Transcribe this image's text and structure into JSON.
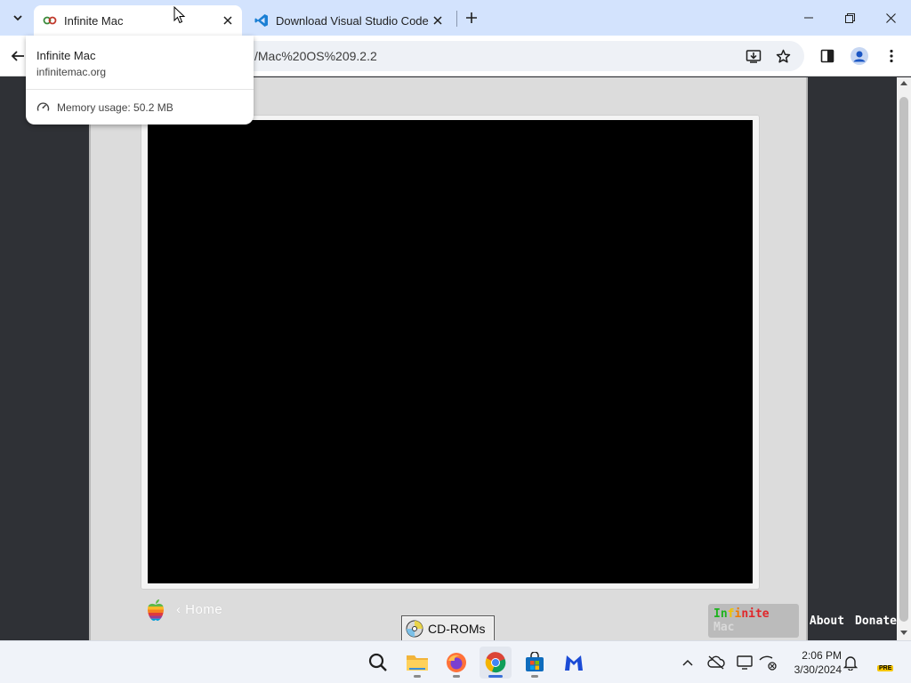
{
  "browser": {
    "tabs": [
      {
        "title": "Infinite Mac",
        "active": true,
        "favicon": "infinite-mac-icon"
      },
      {
        "title": "Download Visual Studio Code",
        "active": false,
        "favicon": "vscode-icon"
      }
    ],
    "address_bar": {
      "url_fragment": "/Mac%20OS%209.2.2"
    },
    "hover_card": {
      "title": "Infinite Mac",
      "domain": "infinitemac.org",
      "memory": "Memory usage: 50.2 MB"
    }
  },
  "page": {
    "home_link": "‹ Home",
    "cd_button": "CD-ROMs",
    "brand": {
      "letters": [
        "In",
        "f",
        "i",
        "n",
        "i",
        "te",
        " Mac"
      ]
    },
    "nav_links": [
      "About",
      "Donate"
    ]
  },
  "taskbar": {
    "apps": [
      "search",
      "file-explorer",
      "firefox",
      "chrome",
      "microsoft-store",
      "malwarebytes"
    ],
    "clock": {
      "time": "2:06 PM",
      "date": "3/30/2024"
    },
    "badge": "PRE"
  },
  "colors": {
    "tabstrip": "#d3e3fd",
    "page_background": "#2f3136",
    "monitor_bezel": "#dcdcdc",
    "screen": "#000000"
  }
}
